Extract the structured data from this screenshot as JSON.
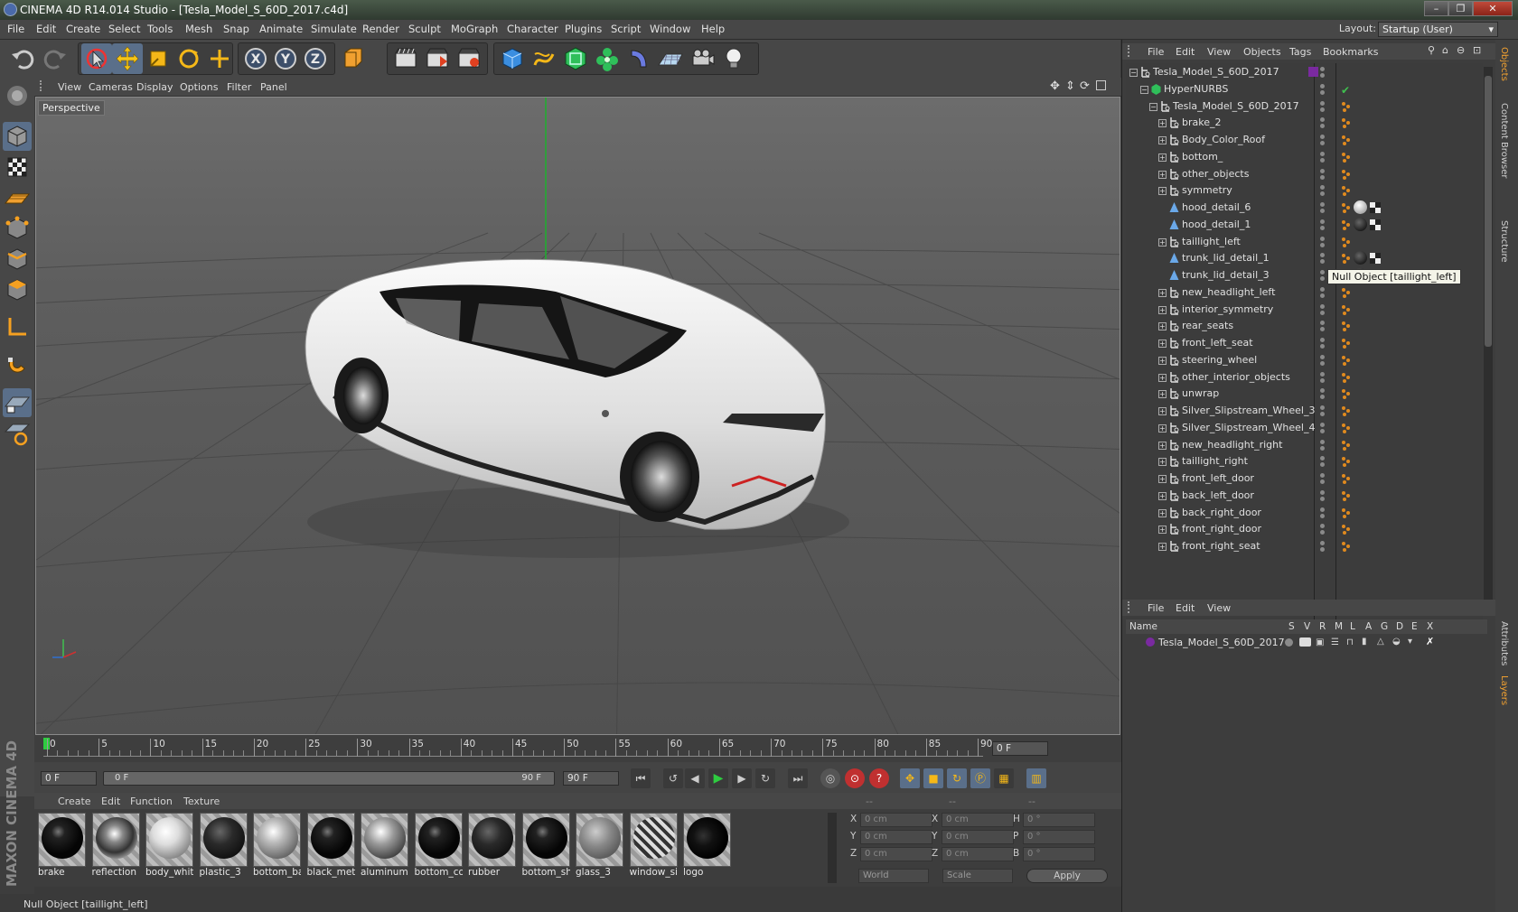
{
  "window": {
    "title": "CINEMA 4D R14.014 Studio - [Tesla_Model_S_60D_2017.c4d]",
    "controls": [
      "–",
      "❐",
      "✕"
    ]
  },
  "menubar": {
    "items": [
      "File",
      "Edit",
      "Create",
      "Select",
      "Tools",
      "Mesh",
      "Snap",
      "Animate",
      "Simulate",
      "Render",
      "Sculpt",
      "MoGraph",
      "Character",
      "Plugins",
      "Script",
      "Window",
      "Help"
    ],
    "layout_label": "Layout:",
    "layout_value": "Startup (User)"
  },
  "toolbar": {
    "axis_x": "X",
    "axis_y": "Y",
    "axis_z": "Z"
  },
  "viewport": {
    "menu": [
      "View",
      "Cameras",
      "Display",
      "Options",
      "Filter",
      "Panel"
    ],
    "camera_label": "Perspective"
  },
  "timeline": {
    "ticks": [
      "0",
      "5",
      "10",
      "15",
      "20",
      "25",
      "30",
      "35",
      "40",
      "45",
      "50",
      "55",
      "60",
      "65",
      "70",
      "75",
      "80",
      "85",
      "90"
    ],
    "current_frame": "0 F",
    "start_field": "0 F",
    "range_start": "0 F",
    "range_end": "90 F",
    "end_field": "90 F"
  },
  "materials": {
    "menu": [
      "Create",
      "Edit",
      "Function",
      "Texture"
    ],
    "items": [
      {
        "name": "brake",
        "style": "black"
      },
      {
        "name": "reflection",
        "style": "chrome"
      },
      {
        "name": "body_white",
        "style": "white"
      },
      {
        "name": "plastic_3",
        "style": "darkgrey"
      },
      {
        "name": "bottom_base",
        "style": "pearl"
      },
      {
        "name": "black_metal",
        "style": "black"
      },
      {
        "name": "aluminum",
        "style": "silver"
      },
      {
        "name": "bottom_col",
        "style": "black"
      },
      {
        "name": "rubber",
        "style": "darkgrey"
      },
      {
        "name": "bottom_sh",
        "style": "black"
      },
      {
        "name": "glass_3",
        "style": "grey"
      },
      {
        "name": "window_si",
        "style": "patterned"
      },
      {
        "name": "logo",
        "style": "logo"
      }
    ]
  },
  "coordinates": {
    "header": [
      "--",
      "--",
      "--"
    ],
    "rows": [
      {
        "l1": "X",
        "v1": "0 cm",
        "l2": "X",
        "v2": "0 cm",
        "l3": "H",
        "v3": "0 °"
      },
      {
        "l1": "Y",
        "v1": "0 cm",
        "l2": "Y",
        "v2": "0 cm",
        "l3": "P",
        "v3": "0 °"
      },
      {
        "l1": "Z",
        "v1": "0 cm",
        "l2": "Z",
        "v2": "0 cm",
        "l3": "B",
        "v3": "0 °"
      }
    ],
    "mode_select": "World",
    "size_select": "Scale",
    "apply_label": "Apply"
  },
  "object_manager": {
    "menu": [
      "File",
      "Edit",
      "View",
      "Objects",
      "Tags",
      "Bookmarks"
    ],
    "tooltip": "Null Object [taillight_left]",
    "objects": [
      {
        "name": "Tesla_Model_S_60D_2017",
        "depth": 0,
        "type": "null",
        "expander": "−",
        "tag": "layer"
      },
      {
        "name": "HyperNURBS",
        "depth": 1,
        "type": "nurbs",
        "expander": "−",
        "tag": "check"
      },
      {
        "name": "Tesla_Model_S_60D_2017",
        "depth": 2,
        "type": "null",
        "expander": "−",
        "tag": "dots"
      },
      {
        "name": "brake_2",
        "depth": 3,
        "type": "null",
        "expander": "+",
        "tag": "dots"
      },
      {
        "name": "Body_Color_Roof",
        "depth": 3,
        "type": "null",
        "expander": "+",
        "tag": "dots"
      },
      {
        "name": "bottom_",
        "depth": 3,
        "type": "null",
        "expander": "+",
        "tag": "dots"
      },
      {
        "name": "other_objects",
        "depth": 3,
        "type": "null",
        "expander": "+",
        "tag": "dots"
      },
      {
        "name": "symmetry",
        "depth": 3,
        "type": "null",
        "expander": "+",
        "tag": "dots"
      },
      {
        "name": "hood_detail_6",
        "depth": 3,
        "type": "poly",
        "expander": "",
        "tag": "mat-white"
      },
      {
        "name": "hood_detail_1",
        "depth": 3,
        "type": "poly",
        "expander": "",
        "tag": "mat-black"
      },
      {
        "name": "taillight_left",
        "depth": 3,
        "type": "null",
        "expander": "+",
        "tag": "dots"
      },
      {
        "name": "trunk_lid_detail_1",
        "depth": 3,
        "type": "poly",
        "expander": "",
        "tag": "mat-black"
      },
      {
        "name": "trunk_lid_detail_3",
        "depth": 3,
        "type": "poly",
        "expander": "",
        "tag": "mat-black"
      },
      {
        "name": "new_headlight_left",
        "depth": 3,
        "type": "null",
        "expander": "+",
        "tag": "dots"
      },
      {
        "name": "interior_symmetry",
        "depth": 3,
        "type": "null",
        "expander": "+",
        "tag": "dots"
      },
      {
        "name": "rear_seats",
        "depth": 3,
        "type": "null",
        "expander": "+",
        "tag": "dots"
      },
      {
        "name": "front_left_seat",
        "depth": 3,
        "type": "null",
        "expander": "+",
        "tag": "dots"
      },
      {
        "name": "steering_wheel",
        "depth": 3,
        "type": "null",
        "expander": "+",
        "tag": "dots"
      },
      {
        "name": "other_interior_objects",
        "depth": 3,
        "type": "null",
        "expander": "+",
        "tag": "dots"
      },
      {
        "name": "unwrap",
        "depth": 3,
        "type": "null",
        "expander": "+",
        "tag": "dots"
      },
      {
        "name": "Silver_Slipstream_Wheel_3",
        "depth": 3,
        "type": "null",
        "expander": "+",
        "tag": "dots"
      },
      {
        "name": "Silver_Slipstream_Wheel_4",
        "depth": 3,
        "type": "null",
        "expander": "+",
        "tag": "dots"
      },
      {
        "name": "new_headlight_right",
        "depth": 3,
        "type": "null",
        "expander": "+",
        "tag": "dots"
      },
      {
        "name": "taillight_right",
        "depth": 3,
        "type": "null",
        "expander": "+",
        "tag": "dots"
      },
      {
        "name": "front_left_door",
        "depth": 3,
        "type": "null",
        "expander": "+",
        "tag": "dots"
      },
      {
        "name": "back_left_door",
        "depth": 3,
        "type": "null",
        "expander": "+",
        "tag": "dots"
      },
      {
        "name": "back_right_door",
        "depth": 3,
        "type": "null",
        "expander": "+",
        "tag": "dots"
      },
      {
        "name": "front_right_door",
        "depth": 3,
        "type": "null",
        "expander": "+",
        "tag": "dots"
      },
      {
        "name": "front_right_seat",
        "depth": 3,
        "type": "null",
        "expander": "+",
        "tag": "dots"
      }
    ]
  },
  "layer_manager": {
    "menu": [
      "File",
      "Edit",
      "View"
    ],
    "columns": [
      "Name",
      "S",
      "V",
      "R",
      "M",
      "L",
      "A",
      "G",
      "D",
      "E",
      "X"
    ],
    "layer_name": "Tesla_Model_S_60D_2017",
    "layer_color": "#7a2aa0"
  },
  "side_tabs": [
    "Objects",
    "Content Browser",
    "Structure",
    "Attributes",
    "Layers"
  ],
  "status": {
    "text": "Null Object [taillight_left]",
    "brand": "MAXON CINEMA 4D"
  },
  "colors": {
    "accent_blue": "#3b7fd9",
    "tag_orange": "#e08a1e",
    "play_green": "#2ecc40",
    "axis_green": "#3fc04f"
  }
}
